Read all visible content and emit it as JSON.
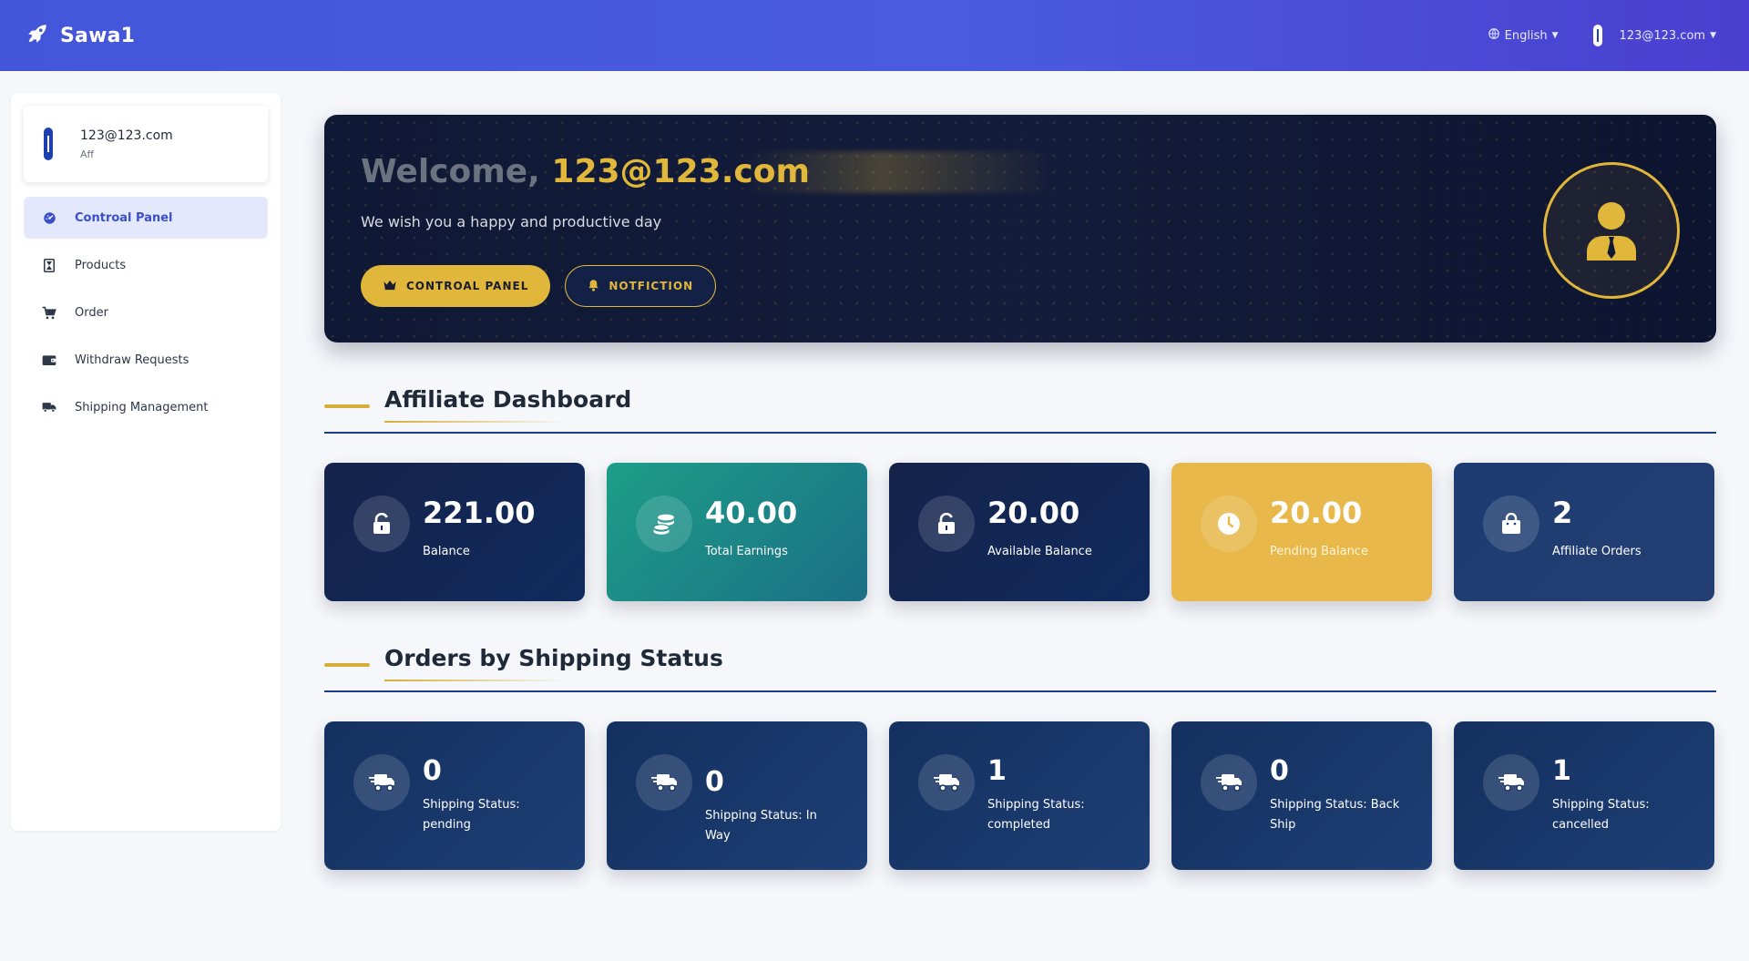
{
  "app": {
    "name": "Sawa1"
  },
  "topbar": {
    "language": "English",
    "user_email": "123@123.com"
  },
  "sidebar": {
    "profile": {
      "email": "123@123.com",
      "role": "Aff"
    },
    "items": [
      {
        "label": "Controal Panel",
        "icon": "dashboard-icon",
        "active": true
      },
      {
        "label": "Products",
        "icon": "hourglass-icon",
        "active": false
      },
      {
        "label": "Order",
        "icon": "cart-icon",
        "active": false
      },
      {
        "label": "Withdraw Requests",
        "icon": "wallet-icon",
        "active": false
      },
      {
        "label": "Shipping Management",
        "icon": "truck-icon",
        "active": false
      }
    ]
  },
  "hero": {
    "welcome": "Welcome,",
    "user": "123@123.com",
    "subtitle": "We wish you a happy and productive day",
    "primary_button": "CONTROAL PANEL",
    "secondary_button": "NOTFICTION"
  },
  "affiliate": {
    "title": "Affiliate Dashboard",
    "cards": [
      {
        "value": "221.00",
        "label": "Balance",
        "icon": "unlock-icon"
      },
      {
        "value": "40.00",
        "label": "Total Earnings",
        "icon": "coins-icon"
      },
      {
        "value": "20.00",
        "label": "Available Balance",
        "icon": "unlock-icon"
      },
      {
        "value": "20.00",
        "label": "Pending Balance",
        "icon": "clock-icon"
      },
      {
        "value": "2",
        "label": "Affiliate Orders",
        "icon": "shopping-bag-icon"
      }
    ]
  },
  "shipping": {
    "title": "Orders by Shipping Status",
    "cards": [
      {
        "value": "0",
        "label": "Shipping Status: pending",
        "icon": "shipping-fast-icon"
      },
      {
        "value": "0",
        "label": "Shipping Status: In Way",
        "icon": "shipping-fast-icon"
      },
      {
        "value": "1",
        "label": "Shipping Status: completed",
        "icon": "shipping-fast-icon"
      },
      {
        "value": "0",
        "label": "Shipping Status: Back Ship",
        "icon": "shipping-fast-icon"
      },
      {
        "value": "1",
        "label": "Shipping Status: cancelled",
        "icon": "shipping-fast-icon"
      }
    ]
  },
  "colors": {
    "navbar": "#4356d9",
    "gold": "#e0b73a",
    "navy": "#15234a",
    "teal": "#1d9e88",
    "active_nav_bg": "#e3e8fd"
  }
}
